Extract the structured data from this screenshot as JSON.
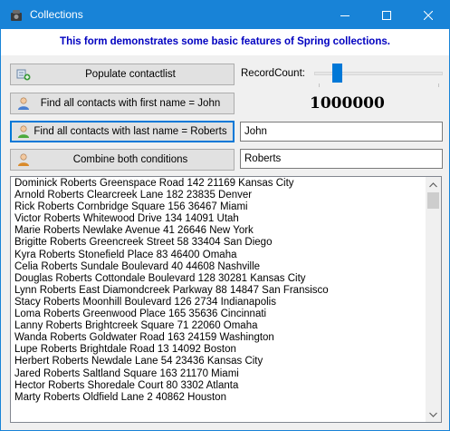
{
  "window": {
    "title": "Collections",
    "icon": "app-icon",
    "controls": [
      "minimize-icon",
      "maximize-icon",
      "close-icon"
    ]
  },
  "banner": {
    "text": "This form demonstrates some basic features of Spring collections.",
    "color": "#0000c0"
  },
  "buttons": {
    "populate": {
      "label": "Populate contactlist",
      "icon": "contacts-add-icon"
    },
    "first_name": {
      "label": "Find all contacts with first name = John",
      "icon": "person-blue-icon"
    },
    "last_name": {
      "label": "Find all contacts with last name = Roberts",
      "icon": "person-green-icon"
    },
    "combine": {
      "label": "Combine both conditions",
      "icon": "person-orange-icon"
    }
  },
  "record_count": {
    "label": "RecordCount:",
    "value": "1000000",
    "slider_position": 0.15
  },
  "inputs": {
    "first_name_value": "John",
    "last_name_value": "Roberts"
  },
  "results": [
    "Dominick Roberts Greenspace Road 142 21169 Kansas City",
    "Arnold Roberts Clearcreek Lane 182 23835 Denver",
    "Rick Roberts Cornbridge Square 156 36467 Miami",
    "Victor Roberts Whitewood Drive 134 14091 Utah",
    "Marie Roberts Newlake Avenue 41 26646 New York",
    "Brigitte Roberts Greencreek Street 58 33404 San Diego",
    "Kyra Roberts Stonefield Place 83 46400 Omaha",
    "Celia Roberts Sundale Boulevard 40 44608 Nashville",
    "Douglas Roberts Cottondale Boulevard 128 30281 Kansas City",
    "Lynn Roberts East Diamondcreek Parkway 88 14847 San Fransisco",
    "Stacy Roberts Moonhill Boulevard 126 2734 Indianapolis",
    "Loma Roberts Greenwood Place 165 35636 Cincinnati",
    "Lanny Roberts Brightcreek Square 71 22060 Omaha",
    "Wanda Roberts Goldwater Road 163 24159 Washington",
    "Lupe Roberts Brightdale Road 13 14092 Boston",
    "Herbert Roberts Newdale Lane 54 23436 Kansas City",
    "Jared Roberts Saltland Square 163 21170 Miami",
    "Hector Roberts Shoredale Court 80 3302 Atlanta",
    "Marty Roberts Oldfield Lane 2 40862 Houston"
  ],
  "colors": {
    "titlebar": "#1883d7",
    "accent": "#0078d7"
  }
}
